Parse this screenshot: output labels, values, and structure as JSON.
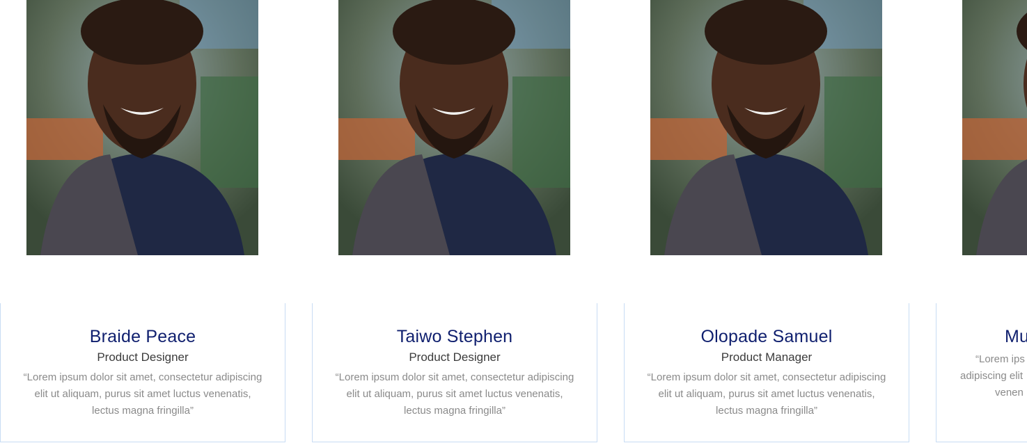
{
  "team": [
    {
      "name": "Braide Peace",
      "role": "Product Designer",
      "quote": "“Lorem ipsum dolor sit amet, consectetur adipiscing elit ut aliquam, purus sit amet luctus venenatis, lectus magna fringilla”"
    },
    {
      "name": "Taiwo Stephen",
      "role": "Product Designer",
      "quote": "“Lorem ipsum dolor sit amet, consectetur adipiscing elit ut aliquam, purus sit amet luctus venenatis, lectus magna fringilla”"
    },
    {
      "name": "Olopade Samuel",
      "role": "Product Manager",
      "quote": "“Lorem ipsum dolor sit amet, consectetur adipiscing elit ut aliquam, purus sit amet luctus venenatis, lectus magna fringilla”"
    },
    {
      "name": "Mu",
      "role": "",
      "quote": "“Lorem ips adipiscing elit venen"
    }
  ],
  "colors": {
    "name": "#0f1f6e",
    "role": "#3b3b3b",
    "quote": "#8a8a8a",
    "card_border": "#c8dcf4"
  }
}
